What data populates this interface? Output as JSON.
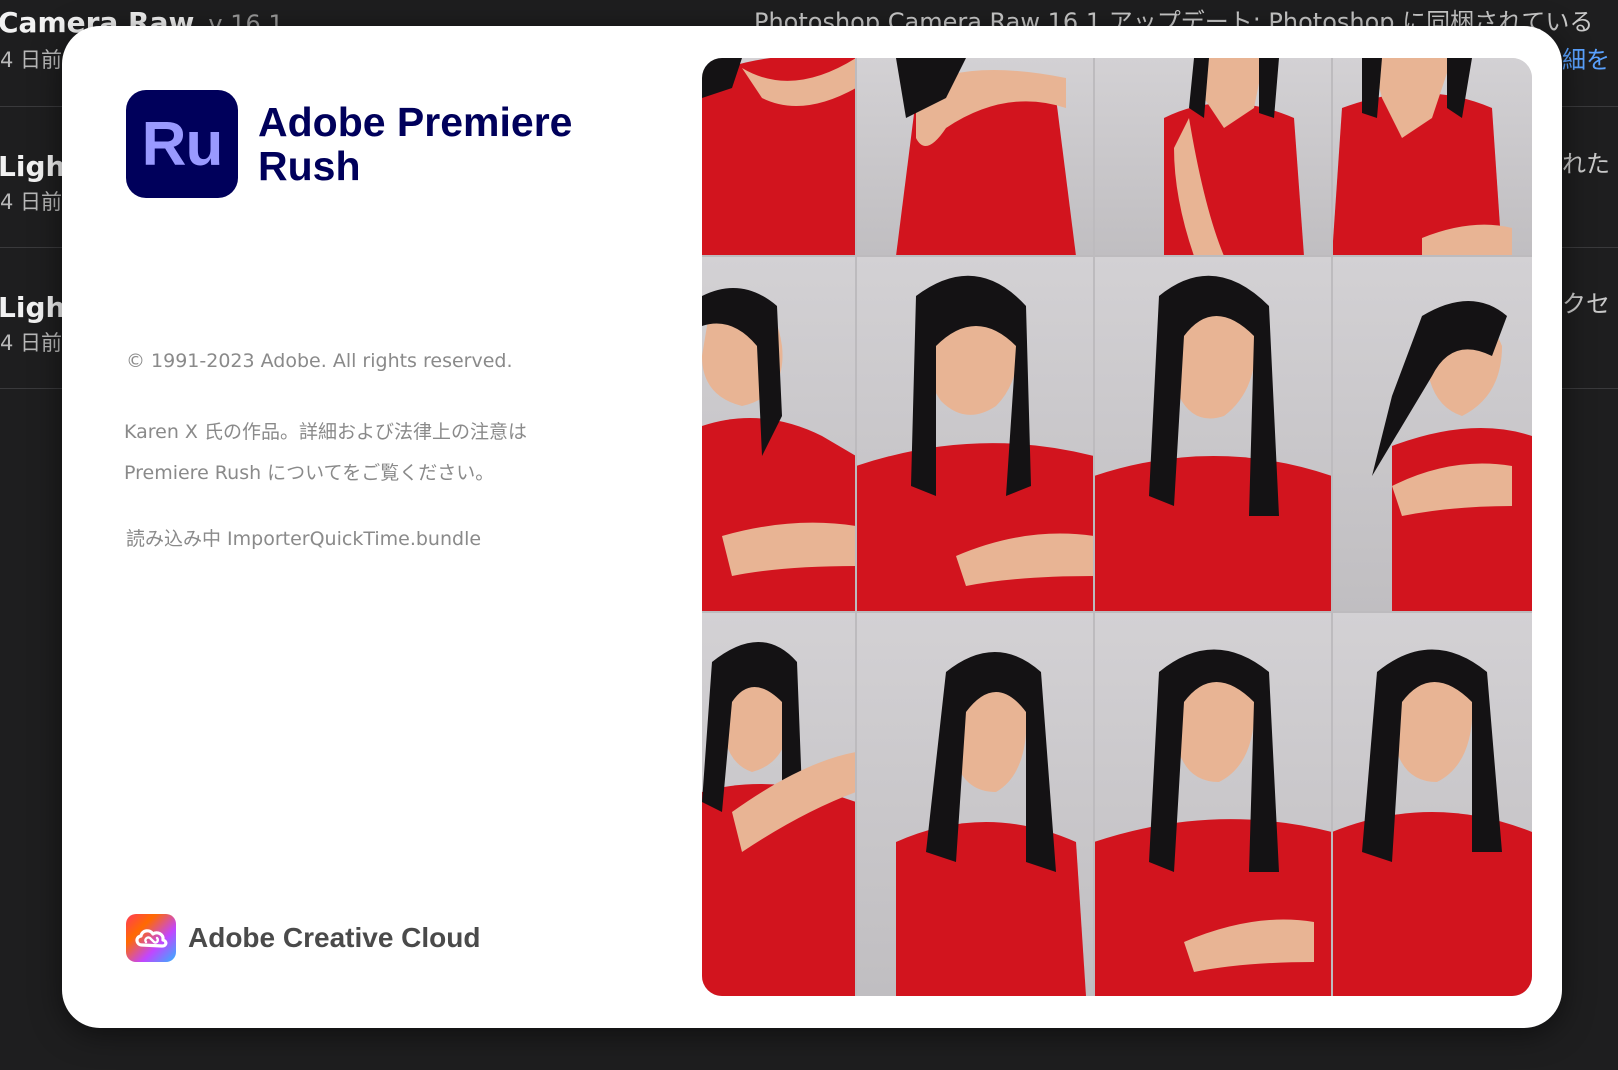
{
  "background": {
    "rows": [
      {
        "title": "Camera Raw",
        "version": "v 16.1",
        "sub": "4 日前"
      },
      {
        "title": "Light",
        "sub": "4 日前"
      },
      {
        "title": "Light",
        "sub": "4 日前"
      }
    ],
    "right_texts": {
      "headline": "Photoshop Camera Raw 16.1 アップデート: Photoshop に同梱されている",
      "link": "細を",
      "row2": "れた",
      "row3": "クセ"
    }
  },
  "splash": {
    "app_icon_text": "Ru",
    "app_name": "Adobe Premiere Rush",
    "copyright": "© 1991-2023 Adobe. All rights reserved.",
    "credits_line1": "Karen X 氏の作品。詳細および法律上の注意は",
    "credits_line2": "Premiere Rush についてをご覧ください。",
    "loading": "読み込み中 ImporterQuickTime.bundle",
    "cc_name": "Adobe Creative Cloud"
  },
  "colors": {
    "rush_dark": "#00005b",
    "rush_light": "#9999ff",
    "red_shirt": "#d2141e",
    "hair": "#141214",
    "skin": "#e8b494",
    "wall": "#c9c7ca"
  },
  "icons": [
    "premiere-rush-app-icon",
    "creative-cloud-icon"
  ]
}
